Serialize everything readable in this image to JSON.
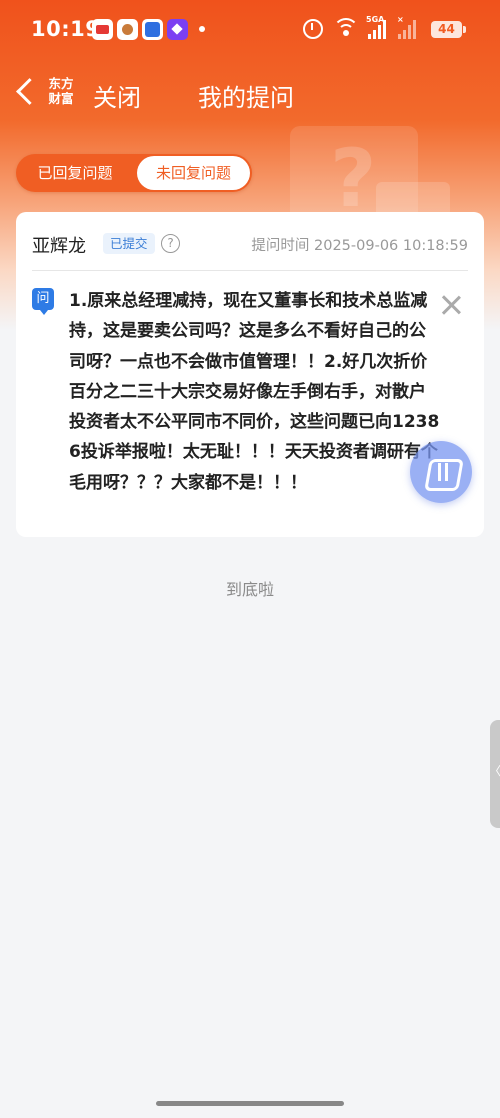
{
  "status_bar": {
    "time": "10:19",
    "network_label": "5GA",
    "battery": "44"
  },
  "nav": {
    "logo_line1": "东方",
    "logo_line2": "财富",
    "close_label": "关闭",
    "title": "我的提问"
  },
  "tabs": [
    {
      "label": "已回复问题",
      "selected": false
    },
    {
      "label": "未回复问题",
      "selected": true
    }
  ],
  "question_card": {
    "user": "亚辉龙",
    "status_badge": "已提交",
    "help_icon": "?",
    "time_label": "提问时间 2025-09-06 10:18:59",
    "question_icon_text": "问",
    "question_text": "1.原来总经理减持，现在又董事长和技术总监减持，这是要卖公司吗？这是多么不看好自己的公司呀？一点也不会做市值管理！！2.好几次折价百分之二三十大宗交易好像左手倒右手，对散户投资者太不公平同市不同价，这些问题已向12386投诉举报啦！太无耻！！！天天投资者调研有个毛用呀？？？大家都不是！！！"
  },
  "list_end_text": "到底啦",
  "colors": {
    "brand_orange": "#f05e23",
    "badge_blue": "#3d7fd6",
    "question_icon_blue": "#2e7be5",
    "page_bg": "#f4f5f7"
  },
  "icons": [
    "back-arrow-icon",
    "alarm-icon",
    "wifi-icon",
    "signal-icon",
    "battery-icon",
    "help-icon",
    "question-icon",
    "close-icon",
    "floating-assistant-icon"
  ]
}
